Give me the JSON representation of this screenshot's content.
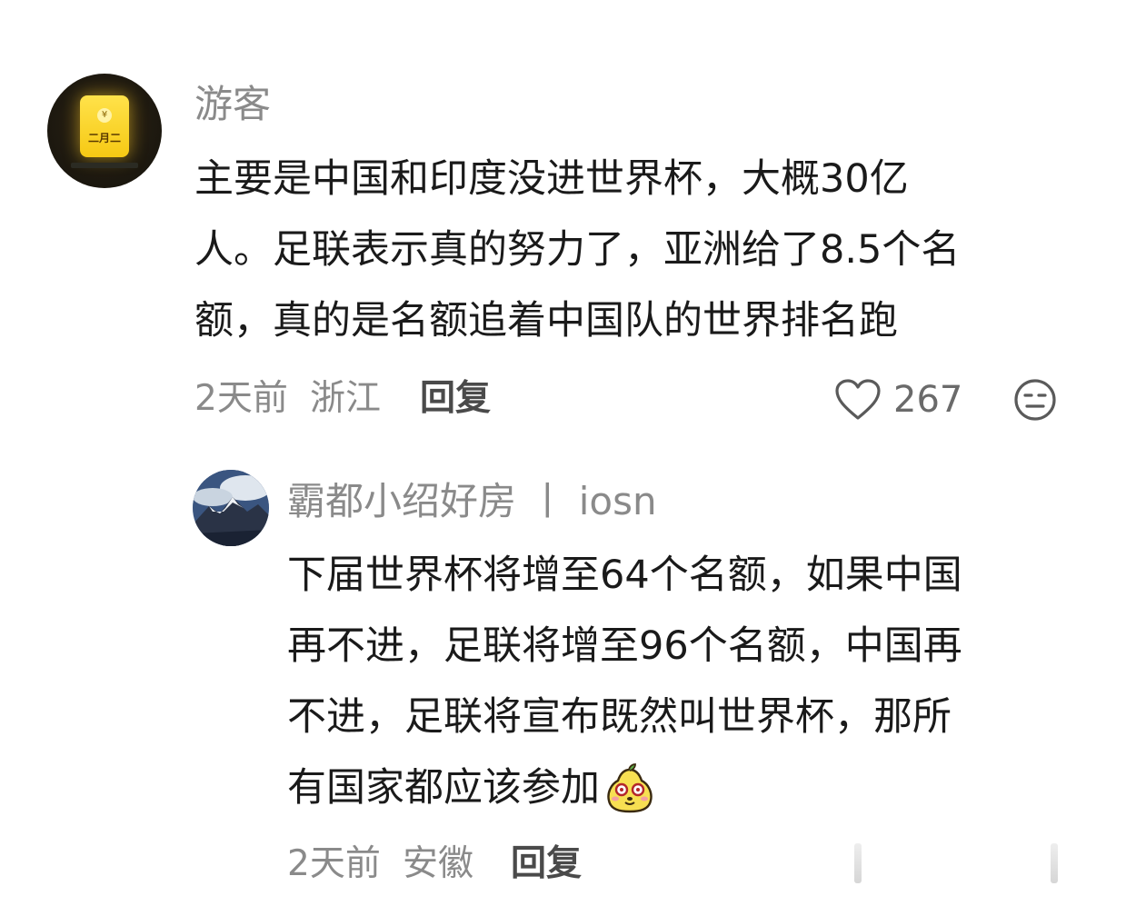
{
  "comment": {
    "username": "游客",
    "avatar_text": "二月二",
    "avatar_coin": "¥",
    "lines": [
      "主要是中国和印度没进世界杯，大概30亿",
      "人。足联表示真的努力了，亚洲给了8.5个名",
      "额，真的是名额追着中国队的世界排名跑"
    ],
    "time": "2天前",
    "location": "浙江",
    "reply_label": "回复",
    "like_count": "267"
  },
  "reply": {
    "username": "霸都小绍好房",
    "separator": "丨",
    "source": "iosn",
    "lines": [
      "下届世界杯将增至64个名额，如果中国",
      "再不进，足联将增至96个名额，中国再",
      "不进，足联将宣布既然叫世界杯，那所",
      "有国家都应该参加"
    ],
    "emoji": "pear-mascot-emoji",
    "time": "2天前",
    "location": "安徽",
    "reply_label": "回复"
  },
  "colors": {
    "text": "#1a1a1a",
    "meta": "#8a8a8a",
    "reply_button": "#4a4a4a",
    "envelope": "#f6c914"
  }
}
